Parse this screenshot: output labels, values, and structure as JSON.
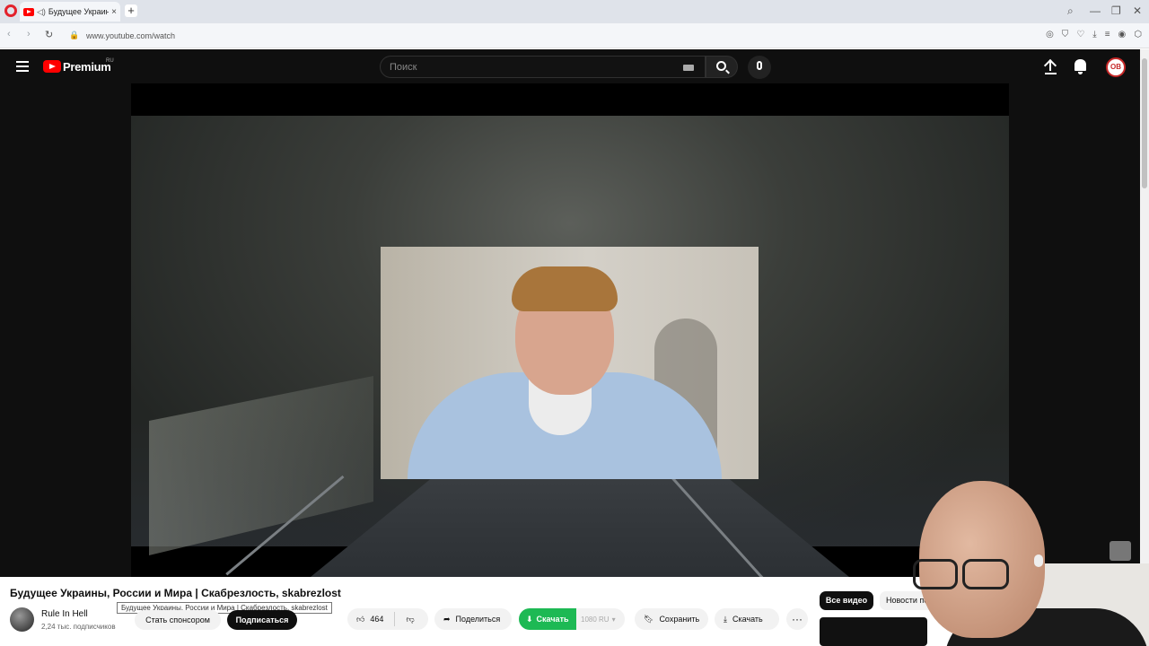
{
  "browser": {
    "tab_title": "Будущее Украины, Р",
    "tab_close": "×",
    "new_tab": "+",
    "url": "www.youtube.com/watch"
  },
  "header": {
    "brand": "Premium",
    "region": "RU",
    "search_placeholder": "Поиск",
    "avatar_text": "OB"
  },
  "video": {
    "title": "Будущее Украины, России и Мира | Скабрезлость, skabrezlost",
    "tooltip": "Будущее Украины, России и Мира | Скабрезлость, skabrezlost",
    "channel_name": "Rule In Hell",
    "channel_subs": "2,24 тыс. подписчиков",
    "sponsor_label": "Стать спонсором",
    "subscribe_label": "Подписаться",
    "like_count": "464",
    "share_label": "Поделиться",
    "download_ext_label": "Скачать",
    "download_quality": "1080 RU",
    "save_label": "Сохранить",
    "download_label": "Скачать",
    "more_label": "···"
  },
  "recommendations": {
    "chips": [
      "Все видео",
      "Новости пол"
    ]
  },
  "colors": {
    "yt_red": "#ff0000",
    "download_green": "#1db954",
    "page_dark": "#0f0f0f"
  }
}
